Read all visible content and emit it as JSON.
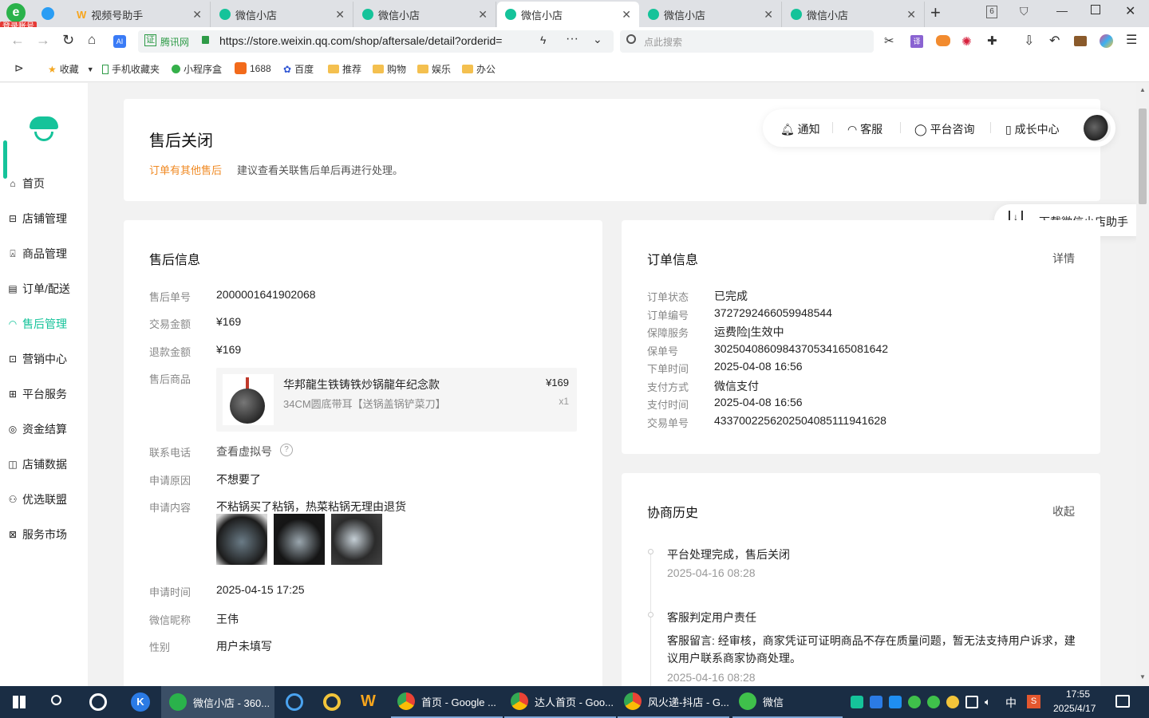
{
  "browser": {
    "login_badge": "登录账号",
    "tabs": [
      {
        "label": "视频号助手"
      },
      {
        "label": "微信小店"
      },
      {
        "label": "微信小店"
      },
      {
        "label": "微信小店"
      },
      {
        "label": "微信小店"
      },
      {
        "label": "微信小店"
      }
    ],
    "tab_count": "6",
    "site_label": "腾讯网",
    "url": "https://store.weixin.qq.com/shop/aftersale/detail?orderid=",
    "search_placeholder": "点此搜索",
    "bookmarks": [
      "收藏",
      "手机收藏夹",
      "小程序盒",
      "1688",
      "百度",
      "推荐",
      "购物",
      "娱乐",
      "办公"
    ]
  },
  "sidebar": {
    "items": [
      {
        "label": "首页"
      },
      {
        "label": "店铺管理"
      },
      {
        "label": "商品管理"
      },
      {
        "label": "订单/配送"
      },
      {
        "label": "售后管理"
      },
      {
        "label": "营销中心"
      },
      {
        "label": "平台服务"
      },
      {
        "label": "资金结算"
      },
      {
        "label": "店铺数据"
      },
      {
        "label": "优选联盟"
      },
      {
        "label": "服务市场"
      }
    ]
  },
  "header": {
    "title": "售后关闭",
    "notice_link": "订单有其他售后",
    "notice_text": "建议查看关联售后单后再进行处理。",
    "tools": [
      "通知",
      "客服",
      "平台咨询",
      "成长中心"
    ],
    "download_helper": "下载微信小店助手"
  },
  "aftersale": {
    "title": "售后信息",
    "rows": [
      {
        "label": "售后单号",
        "value": "2000001641902068"
      },
      {
        "label": "交易金额",
        "value": "¥169"
      },
      {
        "label": "退款金额",
        "value": "¥169"
      }
    ],
    "product_label": "售后商品",
    "product": {
      "name": "华邦龍生铁铸铁炒锅龍年纪念款",
      "spec": "34CM圆底带耳【送锅盖锅铲菜刀】",
      "price": "¥169",
      "qty": "x1"
    },
    "phone_label": "联系电话",
    "phone_link": "查看虚拟号",
    "reason_label": "申请原因",
    "reason": "不想要了",
    "content_label": "申请内容",
    "content": "不粘锅买了粘锅，热菜粘锅无理由退货",
    "time_label": "申请时间",
    "time": "2025-04-15 17:25",
    "nick_label": "微信昵称",
    "nick": "王伟",
    "gender_label": "性别",
    "gender": "用户未填写"
  },
  "order": {
    "title": "订单信息",
    "detail_link": "详情",
    "rows": [
      {
        "label": "订单状态",
        "value": "已完成"
      },
      {
        "label": "订单编号",
        "value": "3727292466059948544"
      },
      {
        "label": "保障服务",
        "value": "运费险|生效中"
      },
      {
        "label": "保单号",
        "value": "30250408609843705341650816​42"
      },
      {
        "label": "下单时间",
        "value": "2025-04-08 16:56"
      },
      {
        "label": "支付方式",
        "value": "微信支付"
      },
      {
        "label": "支付时间",
        "value": "2025-04-08 16:56"
      },
      {
        "label": "交易单号",
        "value": "4337002256202504085111941628"
      }
    ]
  },
  "history": {
    "title": "协商历史",
    "collapse": "收起",
    "items": [
      {
        "title": "平台处理完成，售后关闭",
        "time": "2025-04-16 08:28"
      },
      {
        "title": "客服判定用户责任",
        "message": "客服留言: 经审核，商家凭证可证明商品不存在质量问题，暂无法支持用户诉求，建议用户联系商家协商处理。",
        "time": "2025-04-16 08:28"
      }
    ]
  },
  "taskbar": {
    "apps": [
      "微信小店 - 360...",
      "首页 - Google ...",
      "达人首页 - Goo...",
      "风火递-抖店 - G...",
      "微信"
    ],
    "ime": "中",
    "time": "17:55",
    "date": "2025/4/17"
  }
}
